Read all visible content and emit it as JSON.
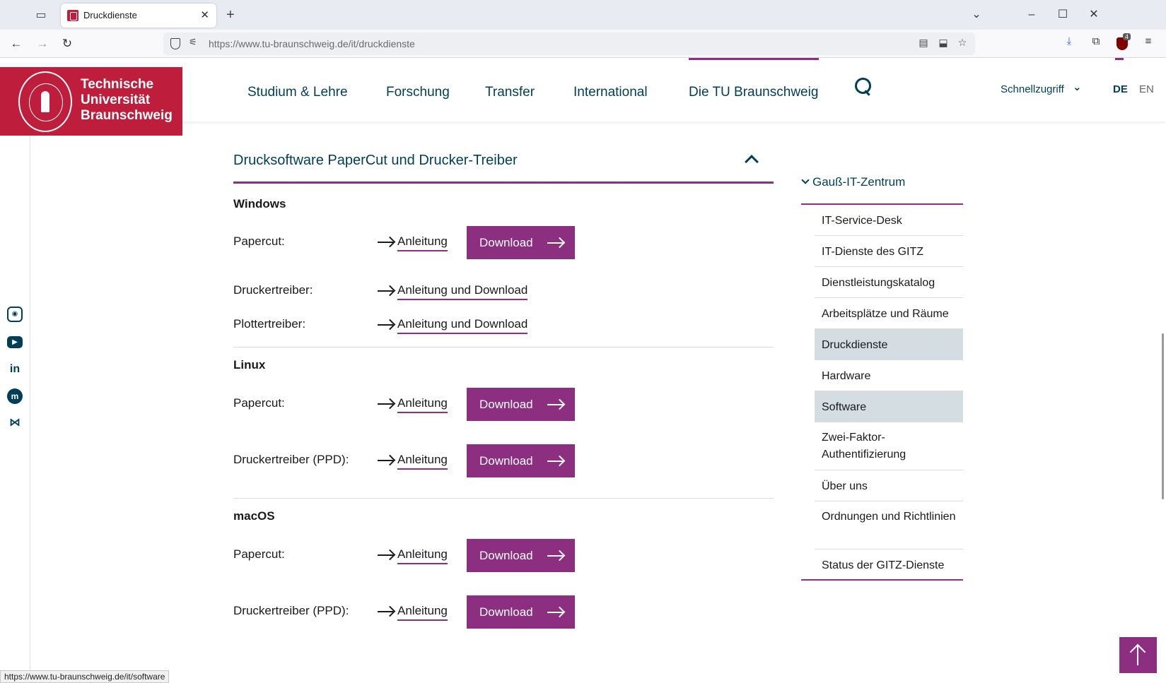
{
  "browser": {
    "tab_title": "Druckdienste",
    "url_host": "https://www.tu-braunschweig.de",
    "url_path": "/it/druckdienste",
    "status_url": "https://www.tu-braunschweig.de/it/software",
    "extension_badge": "4"
  },
  "header": {
    "logo_line1": "Technische",
    "logo_line2": "Universität",
    "logo_line3": "Braunschweig",
    "nav": [
      "Studium & Lehre",
      "Forschung",
      "Transfer",
      "International",
      "Die TU Braunschweig"
    ],
    "quick_access": "Schnellzugriff",
    "lang_de": "DE",
    "lang_en": "EN"
  },
  "accordion": {
    "title": "Drucksoftware PaperCut und Drucker-Treiber"
  },
  "sections": {
    "windows": {
      "heading": "Windows",
      "rows": [
        {
          "label": "Papercut:",
          "link": "Anleitung",
          "button": "Download"
        },
        {
          "label": "Druckertreiber:",
          "link": "Anleitung und Download"
        },
        {
          "label": "Plottertreiber:",
          "link": "Anleitung und Download"
        }
      ]
    },
    "linux": {
      "heading": "Linux",
      "rows": [
        {
          "label": "Papercut:",
          "link": "Anleitung",
          "button": "Download"
        },
        {
          "label": "Druckertreiber (PPD):",
          "link": "Anleitung",
          "button": "Download"
        }
      ]
    },
    "macos": {
      "heading": "macOS",
      "rows": [
        {
          "label": "Papercut:",
          "link": "Anleitung",
          "button": "Download"
        },
        {
          "label": "Druckertreiber (PPD):",
          "link": "Anleitung",
          "button": "Download"
        }
      ]
    }
  },
  "sidenav": {
    "title": "Gauß-IT-Zentrum",
    "items": [
      "IT-Service-Desk",
      "IT-Dienste des GITZ",
      "Dienstleistungskatalog",
      "Arbeitsplätze und Räume",
      "Druckdienste",
      "Hardware",
      "Software",
      "Zwei-Faktor-Authentifizierung",
      "Über uns",
      "Ordnungen und Richtlinien",
      "Status der GITZ-Dienste"
    ],
    "active_items": [
      "Druckdienste",
      "Software"
    ]
  },
  "colors": {
    "tu_red": "#be1e3c",
    "accent_purple": "#8c2f80",
    "nav_blue": "#003f57",
    "active_bg": "#d3dde2"
  },
  "icons": {
    "social": [
      "instagram-icon",
      "youtube-icon",
      "linkedin-icon",
      "mastodon-icon",
      "bluesky-icon"
    ]
  }
}
